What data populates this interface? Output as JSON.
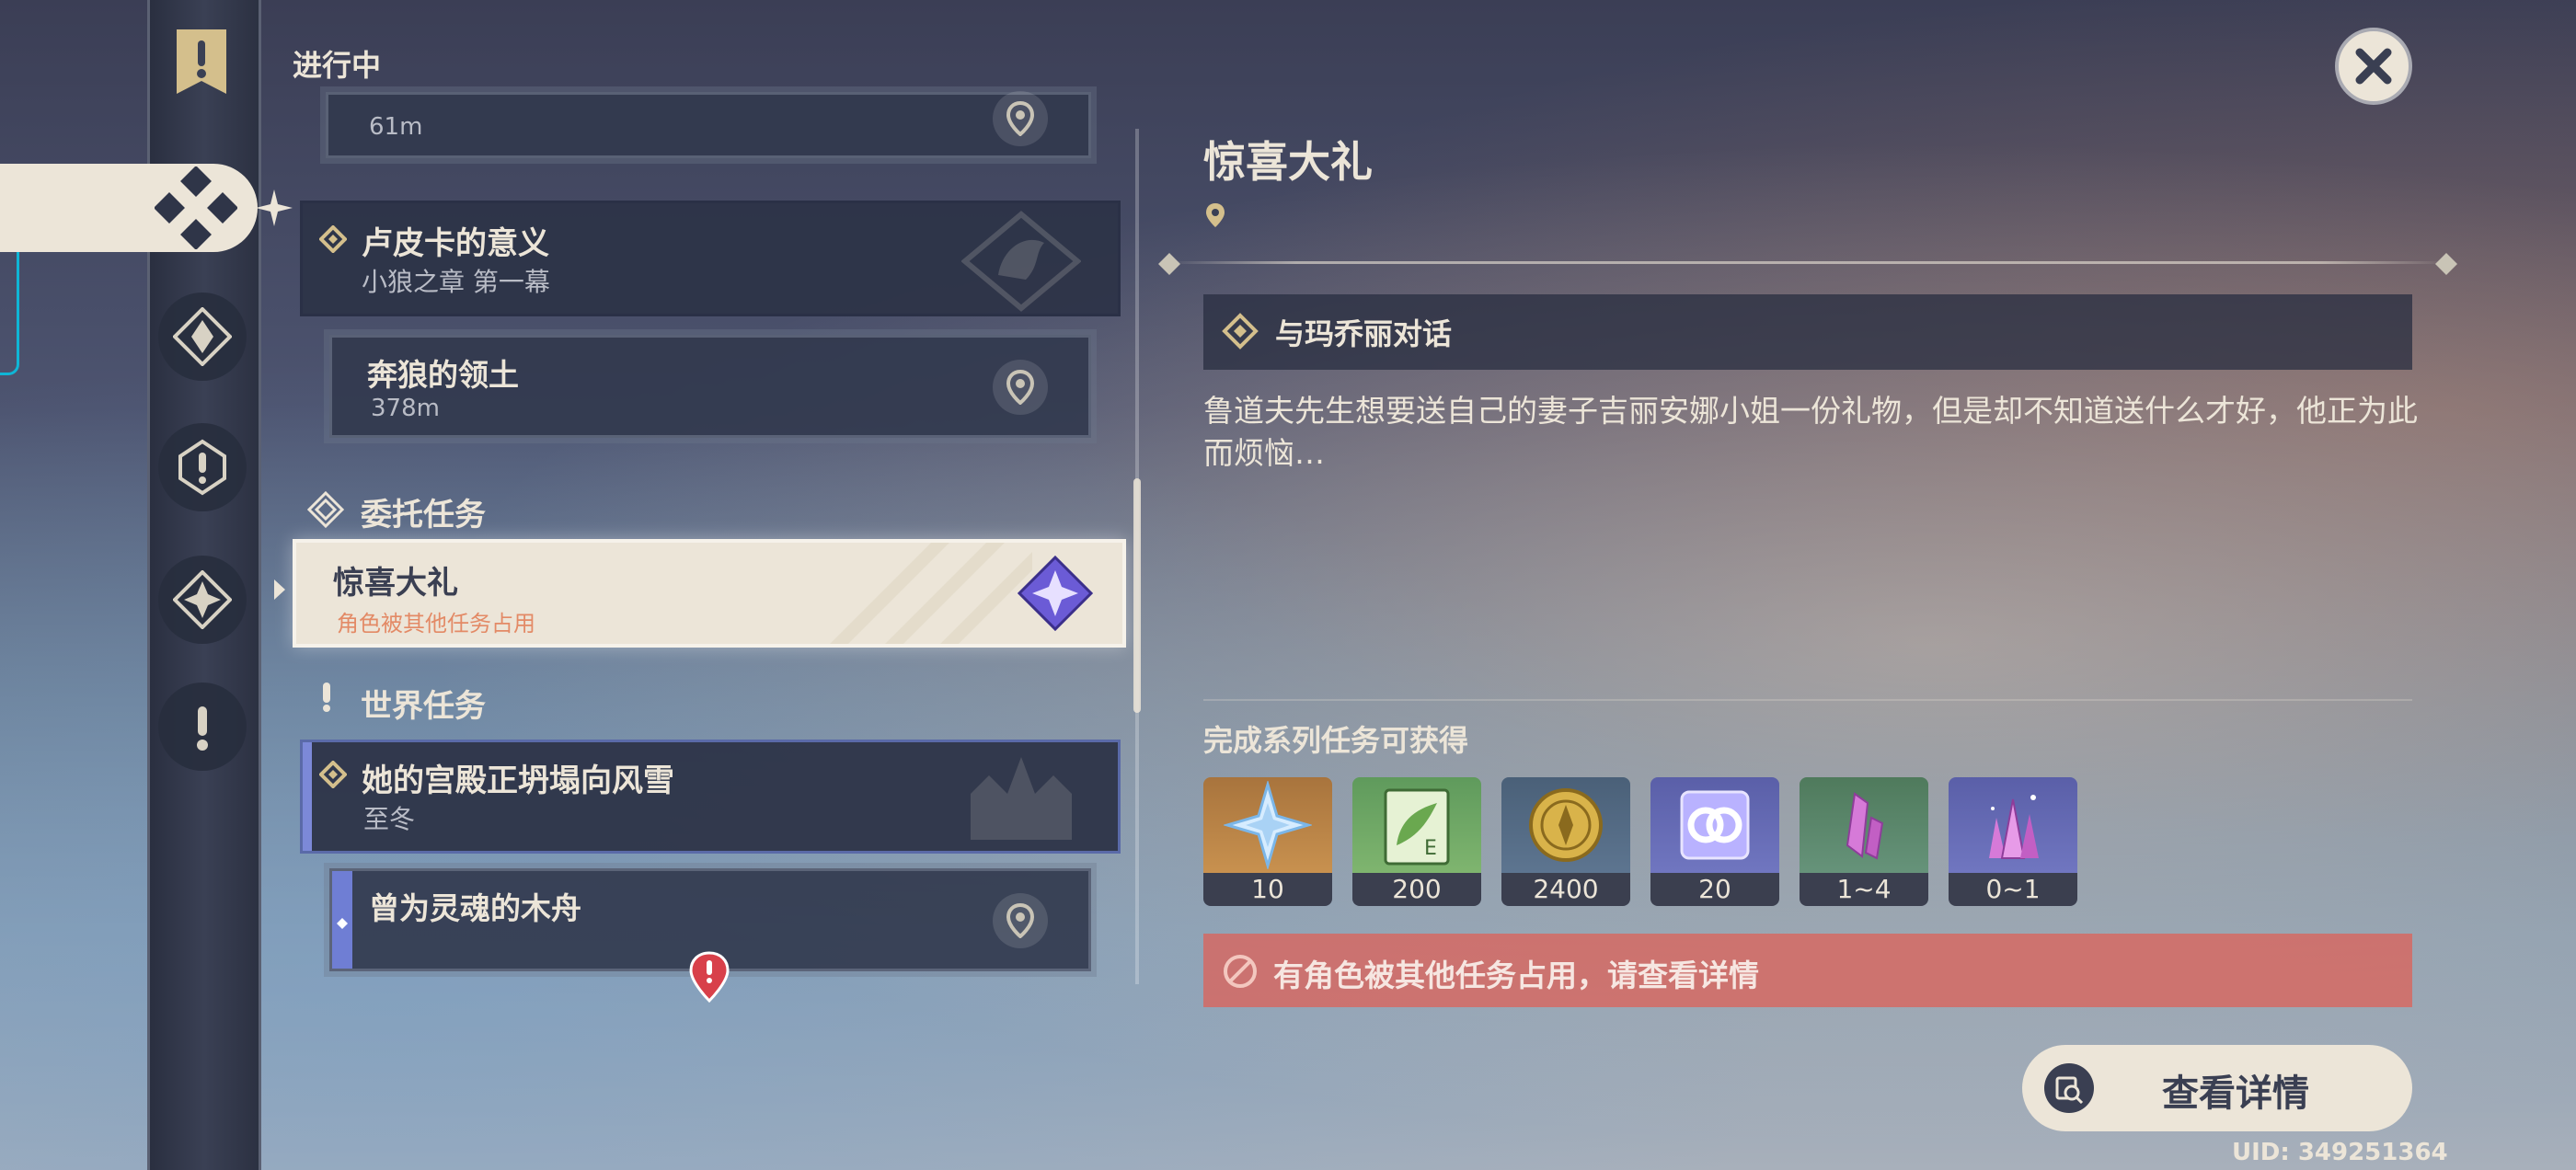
{
  "header": {
    "section_title": "进行中"
  },
  "quest_list": {
    "top_partial": {
      "distance": "61m"
    },
    "archon_chain": {
      "title": "卢皮卡的意义",
      "subtitle": "小狼之章 第一幕"
    },
    "archon_step": {
      "title": "奔狼的领土",
      "distance": "378m"
    },
    "commission_category": "委托任务",
    "selected_quest": {
      "title": "惊喜大礼",
      "status": "角色被其他任务占用"
    },
    "world_category": "世界任务",
    "world_chain": {
      "title": "她的宫殿正坍塌向风雪",
      "subtitle": "至冬"
    },
    "world_step": {
      "title": "曾为灵魂的木舟"
    }
  },
  "detail": {
    "title": "惊喜大礼",
    "objective": "与玛乔丽对话",
    "description": "鲁道夫先生想要送自己的妻子吉丽安娜小姐一份礼物，但是却不知道送什么才好，他正为此而烦恼…",
    "rewards_heading": "完成系列任务可获得",
    "rewards": [
      {
        "icon": "primogem-icon",
        "count": "10"
      },
      {
        "icon": "adventure-exp-icon",
        "count": "200"
      },
      {
        "icon": "mora-icon",
        "count": "2400"
      },
      {
        "icon": "companionship-exp-icon",
        "count": "20"
      },
      {
        "icon": "enhancement-crystal-icon",
        "count": "1~4"
      },
      {
        "icon": "crystal-cluster-icon",
        "count": "0~1"
      }
    ],
    "warning": "有角色被其他任务占用，请查看详情",
    "details_button": "查看详情"
  },
  "uid": "UID: 349251364",
  "colors": {
    "cream": "#ece5d8",
    "panel": "#2d3448",
    "warning": "#de6258",
    "accent_purple": "#6b5bd6",
    "selected_status": "#e38a66"
  }
}
